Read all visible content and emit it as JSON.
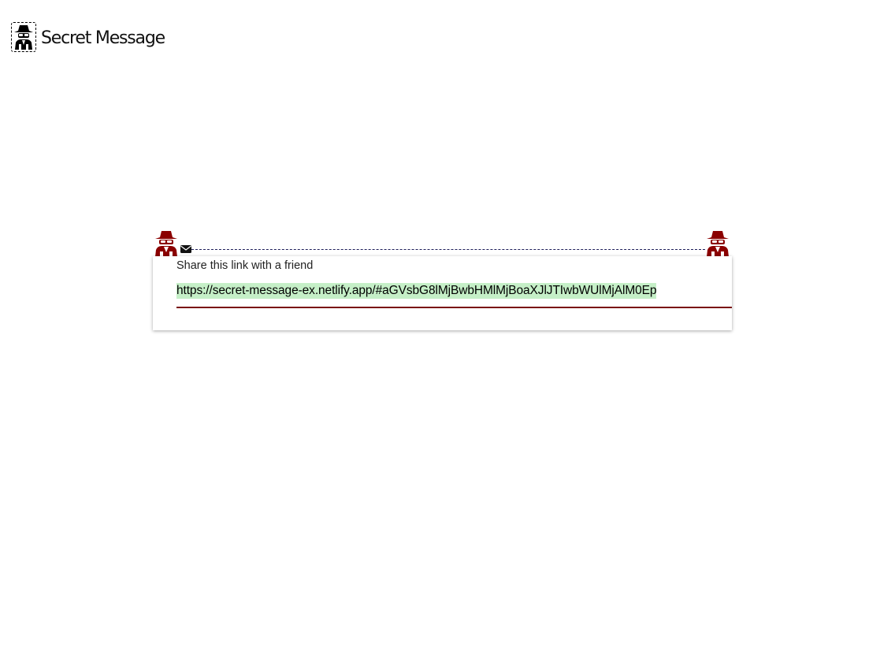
{
  "header": {
    "title": "Secret Message",
    "logo_icon": "spy-icon"
  },
  "share": {
    "label": "Share this link with a friend",
    "link": "https://secret-message-ex.netlify.app/#aGVsbG8lMjBwbHMlMjBoaXJlJTIwbWUlMjAlM0Ep"
  },
  "icons": {
    "left": "spy-icon",
    "right": "spy-icon",
    "connector": "envelope-icon"
  },
  "colors": {
    "accent": "#8b0000",
    "highlight": "#c5efc7",
    "underline": "#7a1010"
  }
}
